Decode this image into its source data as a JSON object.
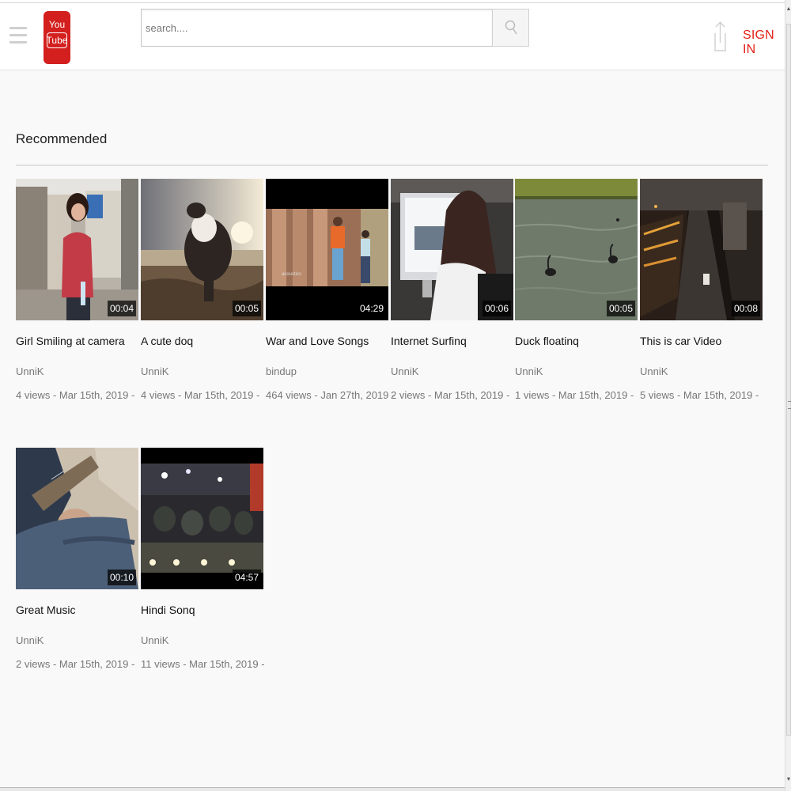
{
  "header": {
    "logo_line1": "You",
    "logo_line2": "Tube",
    "search_placeholder": "search....",
    "sign_in_label": "SIGN IN",
    "accent_color": "#e62117"
  },
  "section": {
    "title": "Recommended"
  },
  "videos": [
    {
      "title": "Girl Smiling at camera",
      "channel": "UnniK",
      "meta": "4 views - Mar 15th, 2019 -",
      "duration": "00:04",
      "thumbnail": "girl-street"
    },
    {
      "title": "A cute doq",
      "channel": "UnniK",
      "meta": "4 views - Mar 15th, 2019 -",
      "duration": "00:05",
      "thumbnail": "dog-beach"
    },
    {
      "title": "War and Love Songs",
      "channel": "bindup",
      "meta": "464 views - Jan 27th, 2019 -",
      "duration": "04:29",
      "thumbnail": "couple-pillars",
      "thumb_caption": "acoustics"
    },
    {
      "title": "Internet Surfinq",
      "channel": "UnniK",
      "meta": "2 views - Mar 15th, 2019 -",
      "duration": "00:06",
      "thumbnail": "woman-computer"
    },
    {
      "title": "Duck floatinq",
      "channel": "UnniK",
      "meta": "1 views - Mar 15th, 2019 -",
      "duration": "00:05",
      "thumbnail": "ducks-lake"
    },
    {
      "title": "This is car Video",
      "channel": "UnniK",
      "meta": "5 views - Mar 15th, 2019 -",
      "duration": "00:08",
      "thumbnail": "city-street-night"
    },
    {
      "title": "Great Music",
      "channel": "UnniK",
      "meta": "2 views - Mar 15th, 2019 -",
      "duration": "00:10",
      "thumbnail": "guitar-player"
    },
    {
      "title": "Hindi Sonq",
      "channel": "UnniK",
      "meta": "11 views - Mar 15th, 2019 -",
      "duration": "04:57",
      "thumbnail": "stage-drummers"
    }
  ]
}
